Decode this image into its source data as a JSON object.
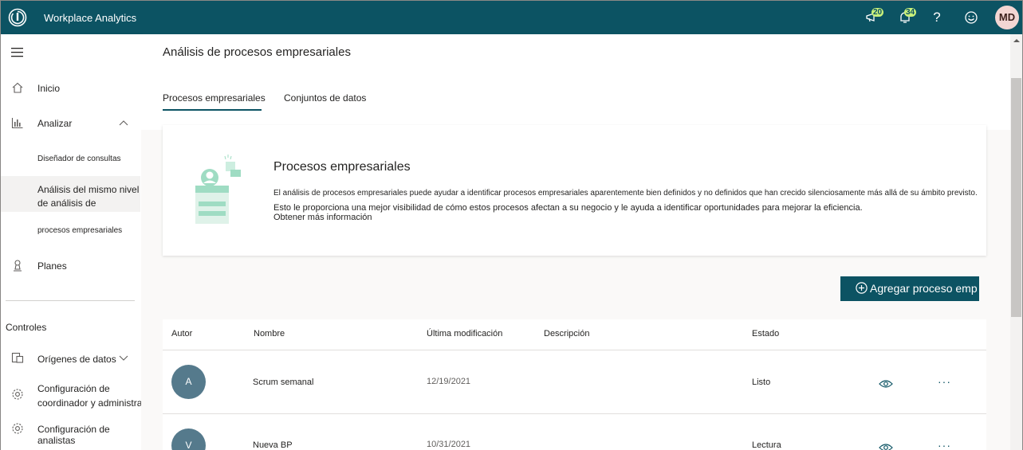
{
  "header": {
    "app_title": "Workplace Analytics",
    "announcements_count": "20",
    "notifications_count": "34",
    "help_label": "?",
    "user_initials": "MD"
  },
  "sidebar": {
    "items": [
      {
        "label": "Inicio",
        "icon": "home-icon"
      },
      {
        "label": "Analizar",
        "icon": "chart-icon"
      },
      {
        "label": "Planes",
        "icon": "plans-icon"
      }
    ],
    "sub_items": [
      "Diseñador de consultas",
      "Análisis del mismo nivel de análisis de",
      "procesos empresariales"
    ],
    "controls_label": "Controles",
    "control_items": [
      {
        "label": "Orígenes de datos",
        "icon": "data-sources-icon"
      },
      {
        "label": "Configuración de coordinador y administrador",
        "icon": "settings-icon"
      },
      {
        "label": "Configuración de analistas",
        "icon": "settings-icon"
      }
    ]
  },
  "main": {
    "page_title": "Análisis de procesos empresariales",
    "tabs": [
      {
        "label": "Procesos empresariales",
        "selected": true
      },
      {
        "label": "Conjuntos de datos",
        "selected": false
      }
    ],
    "card": {
      "title": "Procesos empresariales",
      "desc_line1": "El análisis de procesos empresariales puede ayudar a identificar procesos empresariales aparentemente bien definidos y no definidos que han crecido silenciosamente más allá de su ámbito previsto.",
      "desc_line2": "Esto le proporciona una mejor visibilidad de cómo estos procesos afectan a su negocio y le ayuda a identificar oportunidades para mejorar la eficiencia.",
      "link": "Obtener más información"
    },
    "add_button_label": "Agregar proceso emp",
    "table": {
      "columns": [
        "Autor",
        "Nombre",
        "Última modificación",
        "Descripción",
        "Estado"
      ],
      "rows": [
        {
          "author_initial": "A",
          "name": "Scrum semanal",
          "modified": "12/19/2021",
          "description": "",
          "status": "Listo"
        },
        {
          "author_initial": "V",
          "name": "Nueva BP",
          "modified": "10/31/2021",
          "description": "",
          "status": "Lectura"
        }
      ]
    }
  },
  "colors": {
    "brand": "#0c5363",
    "badge": "#c8f07a",
    "avatar": "#557a8c"
  }
}
